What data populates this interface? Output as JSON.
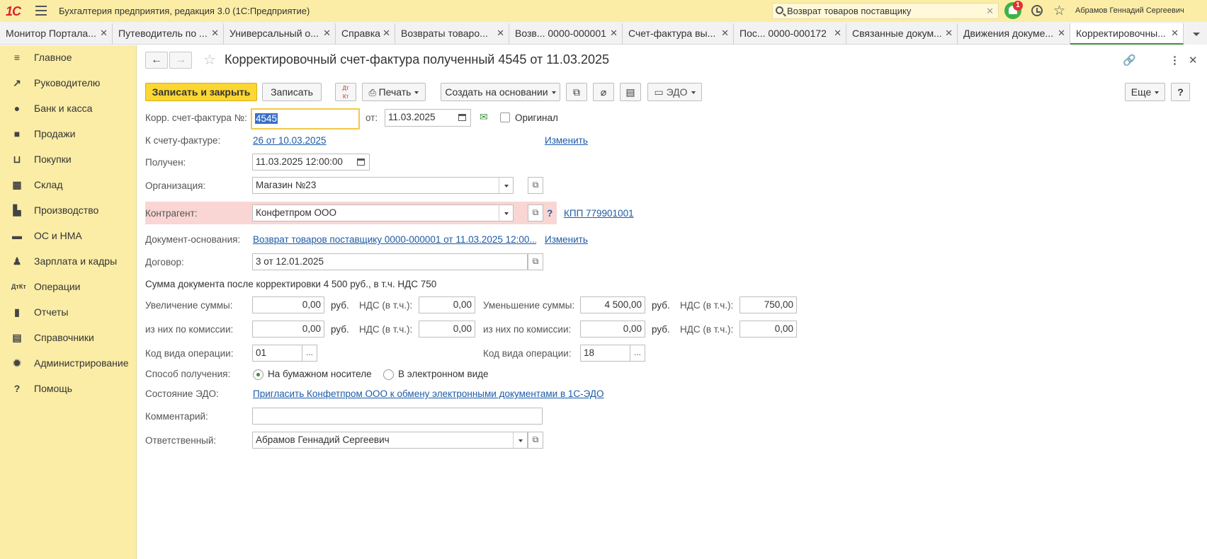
{
  "app": {
    "title": "Бухгалтерия предприятия, редакция 3.0  (1С:Предприятие)",
    "logo": "1С",
    "search_value": "Возврат товаров поставщику",
    "notifications_count": "1",
    "user": "Абрамов Геннадий Сергеевич"
  },
  "tabs": [
    {
      "label": "Монитор Портала..."
    },
    {
      "label": "Путеводитель по ..."
    },
    {
      "label": "Универсальный о..."
    },
    {
      "label": "Справка"
    },
    {
      "label": "Возвраты товаро..."
    },
    {
      "label": "Возв...  0000-000001"
    },
    {
      "label": "Счет-фактура вы..."
    },
    {
      "label": "Пос...  0000-000172"
    },
    {
      "label": "Связанные докум..."
    },
    {
      "label": "Движения докуме..."
    },
    {
      "label": "Корректировочны..."
    }
  ],
  "sidebar": {
    "items": [
      {
        "label": "Главное",
        "icon": "menu-icon"
      },
      {
        "label": "Руководителю",
        "icon": "trend-icon"
      },
      {
        "label": "Банк и касса",
        "icon": "coin-icon"
      },
      {
        "label": "Продажи",
        "icon": "bag-icon"
      },
      {
        "label": "Покупки",
        "icon": "cart-icon"
      },
      {
        "label": "Склад",
        "icon": "grid-icon"
      },
      {
        "label": "Производство",
        "icon": "factory-icon"
      },
      {
        "label": "ОС и НМА",
        "icon": "truck-icon"
      },
      {
        "label": "Зарплата и кадры",
        "icon": "person-icon"
      },
      {
        "label": "Операции",
        "icon": "dtkt-icon"
      },
      {
        "label": "Отчеты",
        "icon": "bar-chart-icon"
      },
      {
        "label": "Справочники",
        "icon": "book-icon"
      },
      {
        "label": "Администрирование",
        "icon": "gear-icon"
      },
      {
        "label": "Помощь",
        "icon": "question-icon"
      }
    ]
  },
  "doc": {
    "title": "Корректировочный счет-фактура полученный 4545 от 11.03.2025"
  },
  "toolbar": {
    "save_close": "Записать и закрыть",
    "save": "Записать",
    "print": "Печать",
    "create_based": "Создать на основании",
    "edo": "ЭДО",
    "more": "Еще",
    "help": "?"
  },
  "form": {
    "number_label": "Корр. счет-фактура №:",
    "number_value": "4545",
    "date_from_label": "от:",
    "date_value": "11.03.2025",
    "original_label": "Оригинал",
    "invoice_label": "К счету-фактуре:",
    "invoice_link": "26 от 10.03.2025",
    "change_label": "Изменить",
    "received_label": "Получен:",
    "received_value": "11.03.2025 12:00:00",
    "org_label": "Организация:",
    "org_value": "Магазин №23",
    "contractor_label": "Контрагент:",
    "contractor_value": "Конфетпром ООО",
    "contractor_help": "?",
    "kpp_link": "КПП 779901001",
    "basis_label": "Документ-основания:",
    "basis_link": "Возврат товаров поставщику 0000-000001 от 11.03.2025 12:00...",
    "change_label2": "Изменить",
    "contract_label": "Договор:",
    "contract_value": "3 от 12.01.2025",
    "sum_summary": "Сумма документа после корректировки 4 500 руб., в т.ч. НДС 750",
    "increase_label": "Увеличение суммы:",
    "increase_value": "0,00",
    "rub": "руб.",
    "vat_incl_label": "НДС (в т.ч.):",
    "increase_vat": "0,00",
    "decrease_label": "Уменьшение суммы:",
    "decrease_value": "4 500,00",
    "decrease_vat": "750,00",
    "commission_label": "из них по комиссии:",
    "inc_commission": "0,00",
    "inc_commission_vat": "0,00",
    "dec_commission": "0,00",
    "dec_commission_vat": "0,00",
    "op_code_label": "Код вида операции:",
    "op_code_left": "01",
    "op_code_right": "18",
    "dots": "...",
    "receipt_label": "Способ получения:",
    "receipt_paper": "На бумажном носителе",
    "receipt_electronic": "В электронном виде",
    "edo_state_label": "Состояние ЭДО:",
    "edo_invite_link": "Пригласить Конфетпром ООО к обмену электронными документами в 1С-ЭДО",
    "comment_label": "Комментарий:",
    "comment_value": "",
    "responsible_label": "Ответственный:",
    "responsible_value": "Абрамов Геннадий Сергеевич"
  },
  "colors": {
    "accent_yellow": "#fbeda6",
    "primary_button": "#fcd632",
    "error_row": "#f9d6d3",
    "link": "#1c5ba8",
    "notification_green": "#3cb34a"
  }
}
